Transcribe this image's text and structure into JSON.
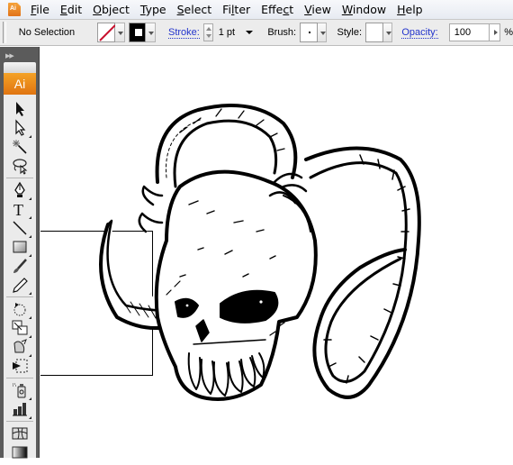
{
  "app": {
    "icon_label": "Ai"
  },
  "menubar": {
    "items": [
      {
        "label": "File",
        "mnemonic": "F"
      },
      {
        "label": "Edit",
        "mnemonic": "E"
      },
      {
        "label": "Object",
        "mnemonic": "O"
      },
      {
        "label": "Type",
        "mnemonic": "T"
      },
      {
        "label": "Select",
        "mnemonic": "S"
      },
      {
        "label": "Filter",
        "mnemonic": "l"
      },
      {
        "label": "Effect",
        "mnemonic": "c"
      },
      {
        "label": "View",
        "mnemonic": "V"
      },
      {
        "label": "Window",
        "mnemonic": "W"
      },
      {
        "label": "Help",
        "mnemonic": "H"
      }
    ]
  },
  "controlbar": {
    "selection_status": "No Selection",
    "fill_color": "none",
    "stroke_color": "#000000",
    "stroke_label": "Stroke:",
    "stroke_weight": "1 pt",
    "brush_label": "Brush:",
    "style_label": "Style:",
    "opacity_label": "Opacity:",
    "opacity_value": "100",
    "opacity_unit": "%"
  },
  "toolspanel": {
    "collapse_glyph": "▶▶",
    "logo": "Ai",
    "tools": [
      {
        "name": "selection-tool"
      },
      {
        "name": "direct-selection-tool"
      },
      {
        "name": "magic-wand-tool"
      },
      {
        "name": "lasso-tool"
      },
      {
        "name": "pen-tool"
      },
      {
        "name": "type-tool",
        "glyph": "T"
      },
      {
        "name": "line-segment-tool"
      },
      {
        "name": "rectangle-tool"
      },
      {
        "name": "paintbrush-tool"
      },
      {
        "name": "pencil-tool"
      },
      {
        "name": "rotate-tool"
      },
      {
        "name": "scale-tool"
      },
      {
        "name": "warp-tool"
      },
      {
        "name": "free-transform-tool"
      },
      {
        "name": "symbol-sprayer-tool"
      },
      {
        "name": "column-graph-tool"
      },
      {
        "name": "mesh-tool"
      },
      {
        "name": "gradient-tool"
      }
    ]
  },
  "canvas": {
    "artwork_description": "Black-and-white ink illustration of a horned ram skull"
  }
}
